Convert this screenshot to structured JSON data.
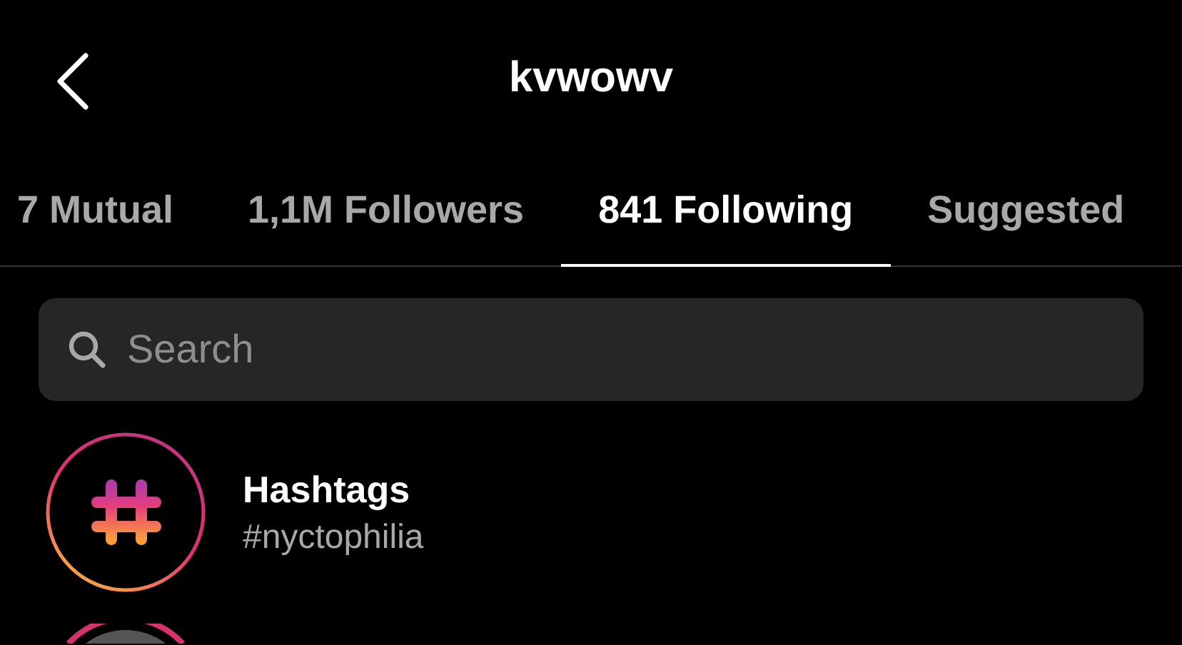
{
  "header": {
    "title": "kvwowv"
  },
  "tabs": [
    {
      "label": "7 Mutual",
      "selected": false
    },
    {
      "label": "1,1M Followers",
      "selected": false
    },
    {
      "label": "841 Following",
      "selected": true
    },
    {
      "label": "Suggested",
      "selected": false
    }
  ],
  "search": {
    "placeholder": "Search"
  },
  "list": [
    {
      "kind": "hashtag",
      "title": "Hashtags",
      "subtitle": "#nyctophilia"
    },
    {
      "kind": "partial"
    }
  ]
}
